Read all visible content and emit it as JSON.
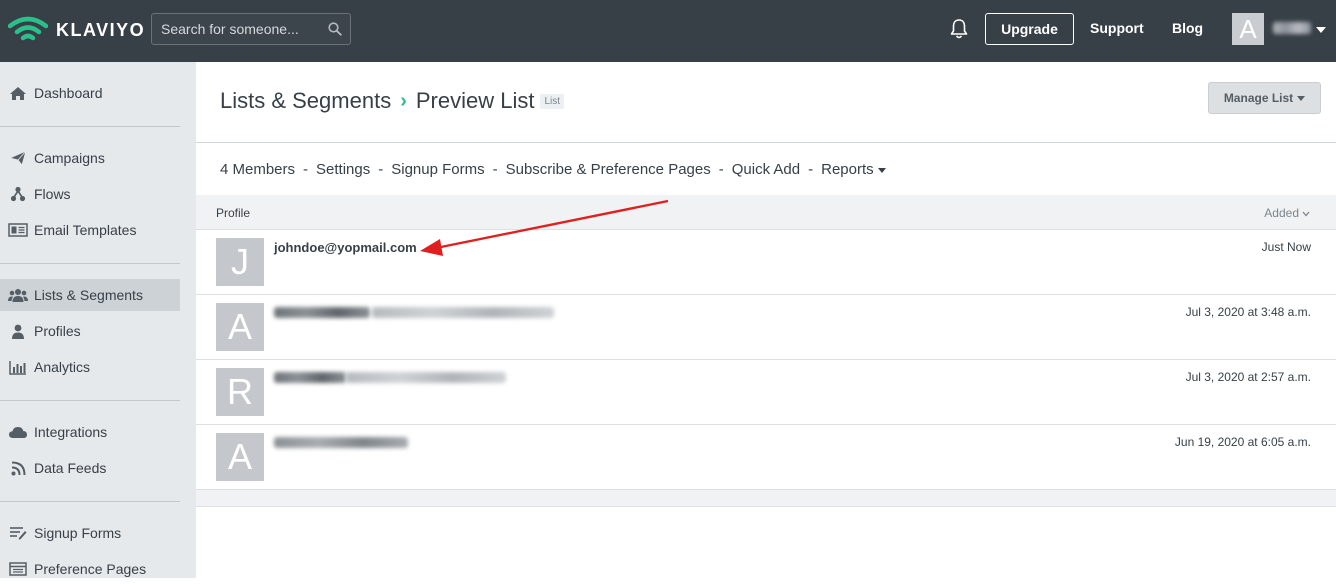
{
  "app": {
    "brand": "KLAVIYO",
    "brand_color": "#2bbf8a",
    "topbar_color": "#373f47"
  },
  "header": {
    "search_placeholder": "Search for someone...",
    "upgrade_label": "Upgrade",
    "support_label": "Support",
    "blog_label": "Blog",
    "avatar_letter": "A"
  },
  "sidebar": {
    "items": [
      {
        "label": "Dashboard",
        "icon": "home-icon"
      },
      {
        "label": "Campaigns",
        "icon": "paper-plane-icon"
      },
      {
        "label": "Flows",
        "icon": "flow-icon"
      },
      {
        "label": "Email Templates",
        "icon": "template-icon"
      },
      {
        "label": "Lists & Segments",
        "icon": "users-icon",
        "active": true
      },
      {
        "label": "Profiles",
        "icon": "user-icon"
      },
      {
        "label": "Analytics",
        "icon": "bar-chart-icon"
      },
      {
        "label": "Integrations",
        "icon": "cloud-icon"
      },
      {
        "label": "Data Feeds",
        "icon": "rss-icon"
      },
      {
        "label": "Signup Forms",
        "icon": "form-icon"
      },
      {
        "label": "Preference Pages",
        "icon": "page-icon"
      }
    ]
  },
  "main": {
    "breadcrumb": {
      "parent": "Lists & Segments",
      "current": "Preview List",
      "badge": "List"
    },
    "manage_label": "Manage List",
    "subnav": [
      "4 Members",
      "Settings",
      "Signup Forms",
      "Subscribe & Preference Pages",
      "Quick Add",
      "Reports"
    ],
    "table": {
      "col_profile": "Profile",
      "col_added": "Added",
      "rows": [
        {
          "avatar": "J",
          "email": "johndoe@yopmail.com",
          "date": "Just Now"
        },
        {
          "avatar": "A",
          "email": "",
          "date": "Jul 3, 2020 at 3:48 a.m."
        },
        {
          "avatar": "R",
          "email": "",
          "date": "Jul 3, 2020 at 2:57 a.m."
        },
        {
          "avatar": "A",
          "email": "",
          "date": "Jun 19, 2020 at 6:05 a.m."
        }
      ]
    }
  }
}
